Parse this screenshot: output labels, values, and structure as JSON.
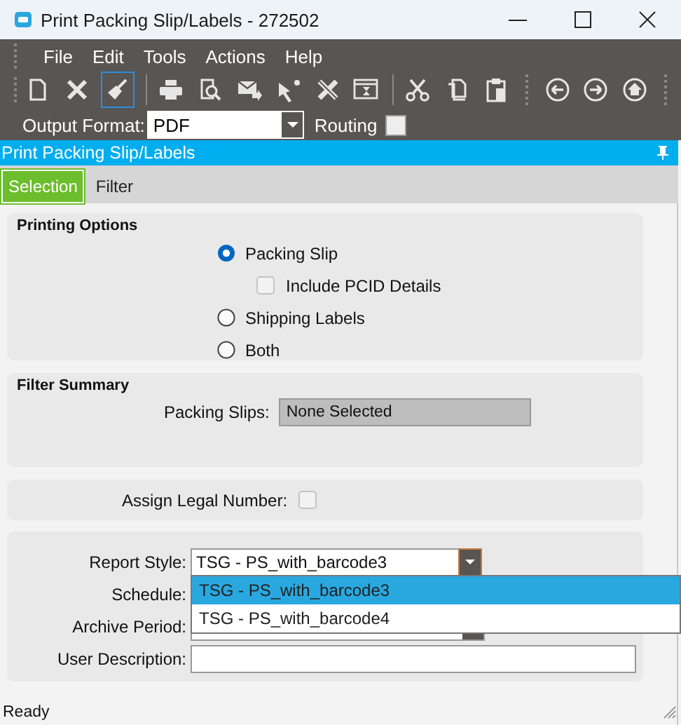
{
  "window": {
    "title": "Print Packing Slip/Labels - 272502"
  },
  "menu": [
    "File",
    "Edit",
    "Tools",
    "Actions",
    "Help"
  ],
  "output_format": {
    "label": "Output Format:",
    "value": "PDF"
  },
  "routing": {
    "label": "Routing",
    "checked": false
  },
  "header": {
    "title": "Print Packing Slip/Labels"
  },
  "tabs": [
    {
      "label": "Selection",
      "selected": true
    },
    {
      "label": "Filter",
      "selected": false
    }
  ],
  "printing_options": {
    "title": "Printing Options",
    "options": [
      {
        "kind": "radio",
        "label": "Packing Slip",
        "selected": true
      },
      {
        "kind": "checkbox",
        "label": "Include PCID Details",
        "checked": false
      },
      {
        "kind": "radio",
        "label": "Shipping Labels",
        "selected": false
      },
      {
        "kind": "radio",
        "label": "Both",
        "selected": false
      }
    ]
  },
  "filter_summary": {
    "title": "Filter Summary",
    "packing_slips": {
      "label": "Packing Slips:",
      "value": "None Selected"
    }
  },
  "assign_legal_number": {
    "label": "Assign Legal Number:",
    "checked": false
  },
  "report_style": {
    "label": "Report Style:",
    "value": "TSG - PS_with_barcode3",
    "options": [
      {
        "label": "TSG - PS_with_barcode3",
        "selected": true
      },
      {
        "label": "TSG - PS_with_barcode4",
        "selected": false
      }
    ]
  },
  "schedule": {
    "label": "Schedule:"
  },
  "archive_period": {
    "label": "Archive Period:"
  },
  "user_description": {
    "label": "User Description:"
  },
  "status_bar": {
    "text": "Ready"
  }
}
